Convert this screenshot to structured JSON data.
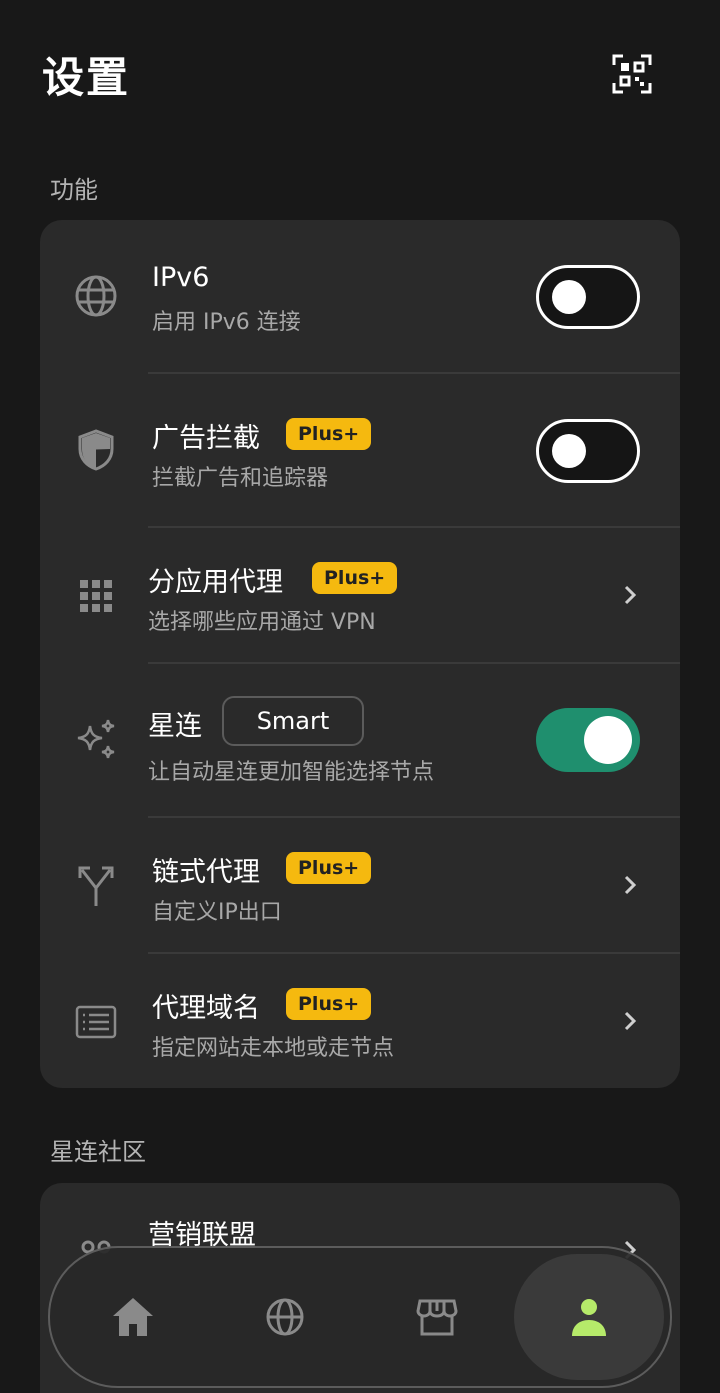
{
  "header": {
    "title": "设置",
    "scan_icon": "qr-scan-icon"
  },
  "sections": {
    "features_label": "功能",
    "community_label": "星连社区"
  },
  "features": {
    "ipv6": {
      "title": "IPv6",
      "subtitle": "启用 IPv6 连接",
      "icon": "globe-icon",
      "enabled": false
    },
    "ad_block": {
      "title": "广告拦截",
      "badge": "Plus+",
      "subtitle": "拦截广告和追踪器",
      "icon": "shield-icon",
      "enabled": false
    },
    "per_app": {
      "title": "分应用代理",
      "badge": "Plus+",
      "subtitle": "选择哪些应用通过 VPN",
      "icon": "grid-icon"
    },
    "star_link": {
      "title": "星连",
      "chip": "Smart",
      "subtitle": "让自动星连更加智能选择节点",
      "icon": "sparkle-icon",
      "enabled": true
    },
    "chain_proxy": {
      "title": "链式代理",
      "badge": "Plus+",
      "subtitle": "自定义IP出口",
      "icon": "fork-icon"
    },
    "proxy_domain": {
      "title": "代理域名",
      "badge": "Plus+",
      "subtitle": "指定网站走本地或走节点",
      "icon": "list-icon"
    }
  },
  "community": {
    "affiliate": {
      "title": "营销联盟",
      "icon": "people-icon"
    }
  },
  "nav": {
    "items": [
      {
        "icon": "home-icon",
        "active": false
      },
      {
        "icon": "globe-icon",
        "active": false
      },
      {
        "icon": "store-icon",
        "active": false
      },
      {
        "icon": "user-icon",
        "active": true
      }
    ],
    "active_color": "#b6ea6a"
  },
  "colors": {
    "background": "#181818",
    "card": "#2a2a2a",
    "badge": "#f5b90f",
    "toggle_on": "#1f8f6e"
  }
}
